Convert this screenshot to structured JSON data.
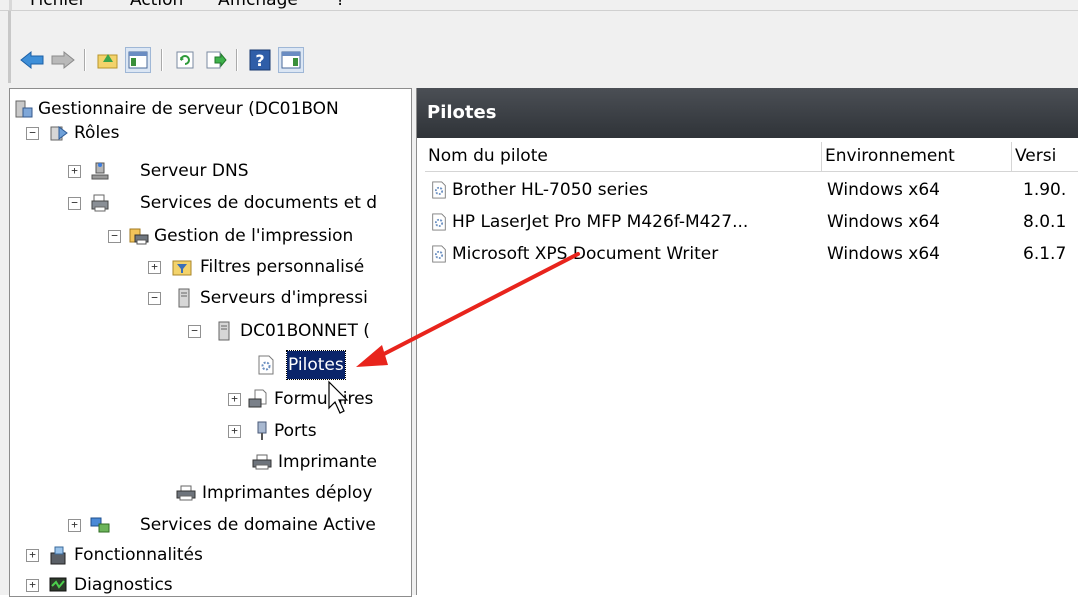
{
  "menu": [
    "Fichier",
    "Action",
    "Affichage",
    "?"
  ],
  "toolbar": {
    "buttons": [
      "back-icon",
      "forward-icon",
      "up-folder-icon",
      "show-hide-tree-icon",
      "refresh-icon",
      "export-list-icon",
      "help-icon",
      "action-pane-icon"
    ]
  },
  "tree": {
    "root": "Gestionnaire de serveur (DC01BON",
    "roles": "Rôles",
    "dns": "Serveur DNS",
    "docservices": "Services de documents et d",
    "printmgmt": "Gestion de l'impression",
    "filters": "Filtres personnalisé",
    "printservers": "Serveurs d'impressi",
    "dc01": "DC01BONNET (",
    "drivers": "Pilotes",
    "forms": "Formulaires",
    "ports": "Ports",
    "printers": "Imprimante",
    "deployed": "Imprimantes déploy",
    "adds": "Services de domaine Active",
    "features": "Fonctionnalités",
    "diagnostics": "Diagnostics"
  },
  "panel": {
    "title": "Pilotes",
    "columns": [
      "Nom du pilote",
      "Environnement",
      "Versi"
    ],
    "rows": [
      {
        "name": "Brother HL-7050 series",
        "env": "Windows x64",
        "ver": "1.90."
      },
      {
        "name": "HP LaserJet Pro MFP M426f-M427...",
        "env": "Windows x64",
        "ver": "8.0.1"
      },
      {
        "name": "Microsoft XPS Document Writer",
        "env": "Windows x64",
        "ver": "6.1.7"
      }
    ]
  },
  "colors": {
    "annotation_arrow": "#e8241c",
    "header_bg": "#3a3e44",
    "selection": "#0a246a"
  }
}
